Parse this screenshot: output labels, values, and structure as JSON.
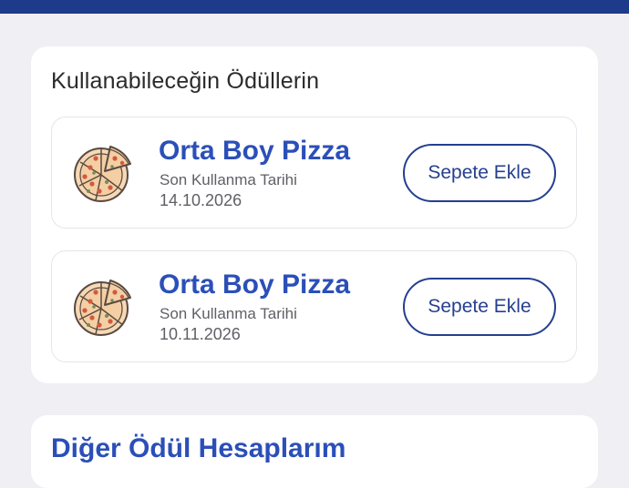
{
  "colors": {
    "top_bar": "#1e3a8a",
    "accent": "#2b4fb8",
    "button_border": "#253f8f",
    "background": "#efeff4",
    "card_border": "#e6e6ec",
    "muted_text": "#5f5f66"
  },
  "rewards": {
    "title": "Kullanabileceğin Ödüllerin",
    "items": [
      {
        "icon": "pizza-icon",
        "name": "Orta Boy Pizza",
        "expiry_label": "Son Kullanma Tarihi",
        "expiry_date": "14.10.2026",
        "button_label": "Sepete Ekle"
      },
      {
        "icon": "pizza-icon",
        "name": "Orta Boy Pizza",
        "expiry_label": "Son Kullanma Tarihi",
        "expiry_date": "10.11.2026",
        "button_label": "Sepete Ekle"
      }
    ]
  },
  "other_rewards": {
    "title": "Diğer Ödül Hesaplarım"
  }
}
